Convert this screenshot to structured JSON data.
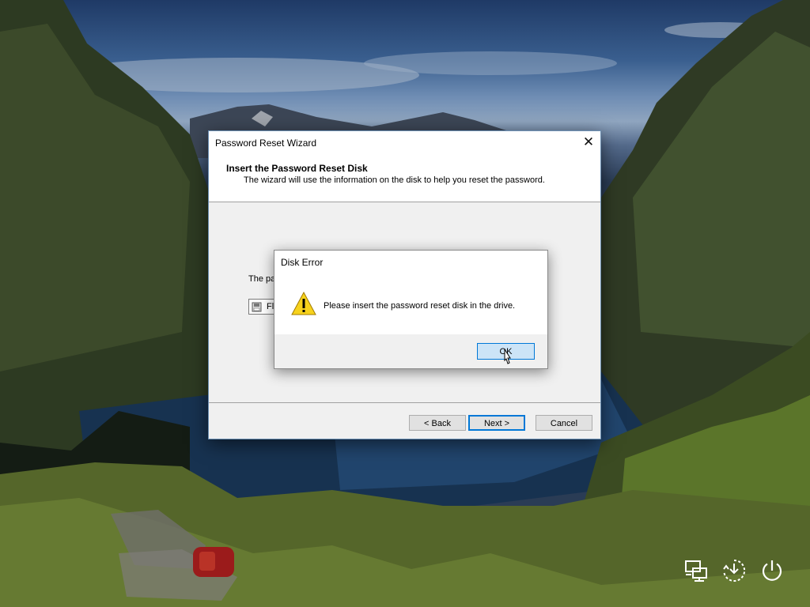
{
  "wizard": {
    "title": "Password Reset Wizard",
    "heading": "Insert the Password Reset Disk",
    "subheading": "The wizard will use the information on the disk to help you reset the password.",
    "body_text_visible": "The pa",
    "drive_label_visible": "Fl",
    "buttons": {
      "back": "< Back",
      "next": "Next >",
      "cancel": "Cancel"
    },
    "close_glyph": "✕"
  },
  "error_dialog": {
    "title": "Disk Error",
    "message": "Please insert the password reset disk in the drive.",
    "ok_label": "OK",
    "icon": "warning-icon"
  },
  "system_icons": [
    "network-icon",
    "ease-of-access-icon",
    "power-icon"
  ],
  "colors": {
    "accent": "#0078d7",
    "ok_button_bg": "#cce4f7",
    "dialog_bg": "#f0f0f0"
  }
}
